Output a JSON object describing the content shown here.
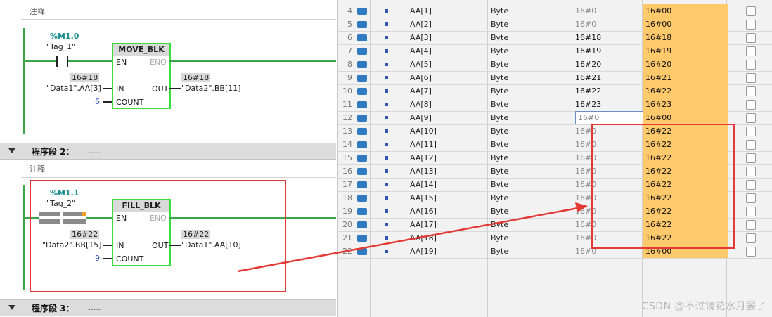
{
  "ladder": {
    "comment_label": "注释",
    "network1": {
      "contact_addr": "%M1.0",
      "contact_tag": "\"Tag_1\"",
      "block_title": "MOVE_BLK",
      "pin_en": "EN",
      "pin_eno": "ENO",
      "pin_in": "IN",
      "pin_out": "OUT",
      "pin_count": "COUNT",
      "in_value": "16#18",
      "in_operand": "\"Data1\".AA[3]",
      "out_value": "16#18",
      "out_operand": "\"Data2\".BB[11]",
      "count_value": "6"
    },
    "segment2": {
      "label": "程序段 2：",
      "dots": "....."
    },
    "network2": {
      "contact_addr": "%M1.1",
      "contact_tag": "\"Tag_2\"",
      "block_title": "FILL_BLK",
      "pin_en": "EN",
      "pin_eno": "ENO",
      "pin_in": "IN",
      "pin_out": "OUT",
      "pin_count": "COUNT",
      "in_value": "16#22",
      "in_operand": "\"Data2\".BB[15]",
      "out_value": "16#22",
      "out_operand": "\"Data1\".AA[10]",
      "count_value": "9"
    },
    "segment3": {
      "label": "程序段 3：",
      "dots": "....."
    }
  },
  "table": {
    "rows": [
      {
        "no": "4",
        "name": "AA[1]",
        "type": "Byte",
        "start": "16#0",
        "monitor": "16#00",
        "start_dark": false
      },
      {
        "no": "5",
        "name": "AA[2]",
        "type": "Byte",
        "start": "16#0",
        "monitor": "16#00",
        "start_dark": false
      },
      {
        "no": "6",
        "name": "AA[3]",
        "type": "Byte",
        "start": "16#18",
        "monitor": "16#18",
        "start_dark": true
      },
      {
        "no": "7",
        "name": "AA[4]",
        "type": "Byte",
        "start": "16#19",
        "monitor": "16#19",
        "start_dark": true
      },
      {
        "no": "8",
        "name": "AA[5]",
        "type": "Byte",
        "start": "16#20",
        "monitor": "16#20",
        "start_dark": true
      },
      {
        "no": "9",
        "name": "AA[6]",
        "type": "Byte",
        "start": "16#21",
        "monitor": "16#21",
        "start_dark": true
      },
      {
        "no": "10",
        "name": "AA[7]",
        "type": "Byte",
        "start": "16#22",
        "monitor": "16#22",
        "start_dark": true
      },
      {
        "no": "11",
        "name": "AA[8]",
        "type": "Byte",
        "start": "16#23",
        "monitor": "16#23",
        "start_dark": true
      },
      {
        "no": "12",
        "name": "AA[9]",
        "type": "Byte",
        "start": "16#0",
        "monitor": "16#00",
        "start_dark": false
      },
      {
        "no": "13",
        "name": "AA[10]",
        "type": "Byte",
        "start": "16#0",
        "monitor": "16#22",
        "start_dark": false
      },
      {
        "no": "14",
        "name": "AA[11]",
        "type": "Byte",
        "start": "16#0",
        "monitor": "16#22",
        "start_dark": false
      },
      {
        "no": "15",
        "name": "AA[12]",
        "type": "Byte",
        "start": "16#0",
        "monitor": "16#22",
        "start_dark": false
      },
      {
        "no": "16",
        "name": "AA[13]",
        "type": "Byte",
        "start": "16#0",
        "monitor": "16#22",
        "start_dark": false
      },
      {
        "no": "17",
        "name": "AA[14]",
        "type": "Byte",
        "start": "16#0",
        "monitor": "16#22",
        "start_dark": false
      },
      {
        "no": "18",
        "name": "AA[15]",
        "type": "Byte",
        "start": "16#0",
        "monitor": "16#22",
        "start_dark": false
      },
      {
        "no": "19",
        "name": "AA[16]",
        "type": "Byte",
        "start": "16#0",
        "monitor": "16#22",
        "start_dark": false
      },
      {
        "no": "20",
        "name": "AA[17]",
        "type": "Byte",
        "start": "16#0",
        "monitor": "16#22",
        "start_dark": false
      },
      {
        "no": "21",
        "name": "AA[18]",
        "type": "Byte",
        "start": "16#0",
        "monitor": "16#22",
        "start_dark": false
      },
      {
        "no": "22",
        "name": "AA[19]",
        "type": "Byte",
        "start": "16#0",
        "monitor": "16#00",
        "start_dark": false
      }
    ]
  },
  "watermark": "CSDN @不过镜花水月罢了",
  "colors": {
    "highlight_red": "#e53935",
    "monitor_orange": "#ffc96c",
    "rail_green": "#3aa64a"
  }
}
